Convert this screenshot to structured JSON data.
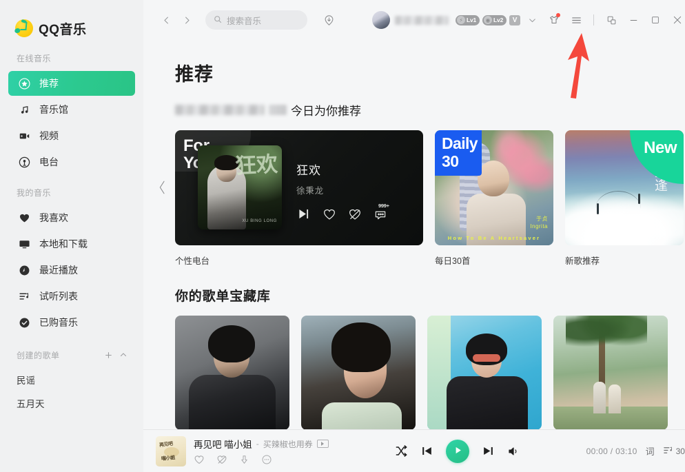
{
  "app": {
    "brand": "QQ音乐",
    "logo_icon": "qq-music-note-logo"
  },
  "sidebar": {
    "groups": [
      {
        "title": "在线音乐",
        "items": [
          {
            "label": "推荐",
            "icon": "star-badge-icon",
            "active": true
          },
          {
            "label": "音乐馆",
            "icon": "music-note-icon",
            "active": false
          },
          {
            "label": "视频",
            "icon": "video-camera-icon",
            "active": false
          },
          {
            "label": "电台",
            "icon": "radio-icon",
            "active": false
          }
        ]
      },
      {
        "title": "我的音乐",
        "items": [
          {
            "label": "我喜欢",
            "icon": "heart-filled-icon",
            "active": false
          },
          {
            "label": "本地和下载",
            "icon": "monitor-icon",
            "active": false
          },
          {
            "label": "最近播放",
            "icon": "clock-icon",
            "active": false
          },
          {
            "label": "试听列表",
            "icon": "playlist-note-icon",
            "active": false
          },
          {
            "label": "已购音乐",
            "icon": "check-circle-icon",
            "active": false
          }
        ]
      }
    ],
    "created_playlists": {
      "title": "创建的歌单",
      "add_icon": "plus-icon",
      "collapse_icon": "chevron-up-icon",
      "items": [
        {
          "label": "民谣"
        },
        {
          "label": "五月天"
        }
      ]
    }
  },
  "topbar": {
    "back_icon": "chevron-left-icon",
    "forward_icon": "chevron-right-icon",
    "search": {
      "placeholder": "搜索音乐",
      "value": "",
      "icon": "search-icon"
    },
    "download_icon": "download-manager-icon",
    "user": {
      "avatar_icon": "avatar",
      "name_redacted": true
    },
    "badges": [
      {
        "label": "Lv1",
        "icon": "lightning-icon"
      },
      {
        "label": "Lv2",
        "icon": "vinyl-icon"
      },
      {
        "label": "V",
        "icon": "vip-v-icon"
      }
    ],
    "expand_icon": "chevron-down-icon",
    "skin_icon": "skin-shirt-icon",
    "skin_has_notification": true,
    "menu_icon": "hamburger-menu-icon",
    "mini_icon": "mini-window-icon",
    "minimize_icon": "minimize-icon",
    "maximize_icon": "maximize-icon",
    "close_icon": "close-icon"
  },
  "annotation": {
    "arrow_color": "#f4483c",
    "points_to": "hamburger-menu-icon"
  },
  "content": {
    "page_title": "推荐",
    "subtitle_suffix": "今日为你推荐",
    "carousel": {
      "prev_icon": "chevron-left-icon",
      "next_icon": "chevron-right-icon",
      "cards": [
        {
          "type": "for-you",
          "tag": "For\nYou",
          "tag_line1": "For",
          "tag_line2": "You",
          "song": "狂欢",
          "artist": "徐秉龙",
          "cover_cjk": "狂欢",
          "cover_credit": "徐秉龙\nXU BING LONG",
          "actions": [
            {
              "icon": "play-next-icon"
            },
            {
              "icon": "heart-outline-icon"
            },
            {
              "icon": "heart-broken-icon"
            },
            {
              "icon": "comment-icon",
              "count": "999+"
            }
          ],
          "label": "个性电台"
        },
        {
          "type": "daily-30",
          "tag_line1": "Daily",
          "tag_line2": "30",
          "cover_caption": "How To Be A Heartsaver",
          "cover_artist": "于贞\nIngrita",
          "label": "每日30首",
          "tag_color": "#1a5cf0"
        },
        {
          "type": "new",
          "tag": "New",
          "cover_title": "陌峪重逢",
          "label": "新歌推荐",
          "tag_color": "#18d59a"
        }
      ]
    },
    "section2": {
      "title": "你的歌单宝藏库",
      "cards": [
        {
          "art": "portrait-man-suit"
        },
        {
          "art": "portrait-woman-closeup"
        },
        {
          "art": "portrait-man-sunglasses"
        },
        {
          "art": "photo-couple-palms"
        }
      ]
    }
  },
  "player": {
    "cover_icon": "album-art",
    "cover_text1": "再见吧",
    "cover_text2": "喵小姐",
    "title": "再见吧 喵小姐",
    "separator": "-",
    "artist": "买辣椒也用券",
    "mv_icon": "mv-play-icon",
    "actions": [
      {
        "icon": "heart-outline-icon"
      },
      {
        "icon": "heart-broken-icon"
      },
      {
        "icon": "download-icon"
      },
      {
        "icon": "more-dots-icon"
      }
    ],
    "controls": {
      "shuffle_icon": "shuffle-icon",
      "prev_icon": "previous-track-icon",
      "play_icon": "play-icon",
      "next_icon": "next-track-icon",
      "volume_icon": "volume-icon"
    },
    "current_time": "00:00",
    "time_separator": "/",
    "total_time": "03:10",
    "lyrics_label": "词",
    "queue_icon": "queue-list-icon",
    "queue_count": "30"
  },
  "colors": {
    "accent_green": "#2ac893",
    "accent_green_light": "#2fd4a8",
    "daily_blue": "#1a5cf0",
    "new_green": "#18d59a",
    "annotation_red": "#f4483c",
    "sidebar_bg": "#f0f1f2",
    "main_bg": "#f5f6f7"
  }
}
